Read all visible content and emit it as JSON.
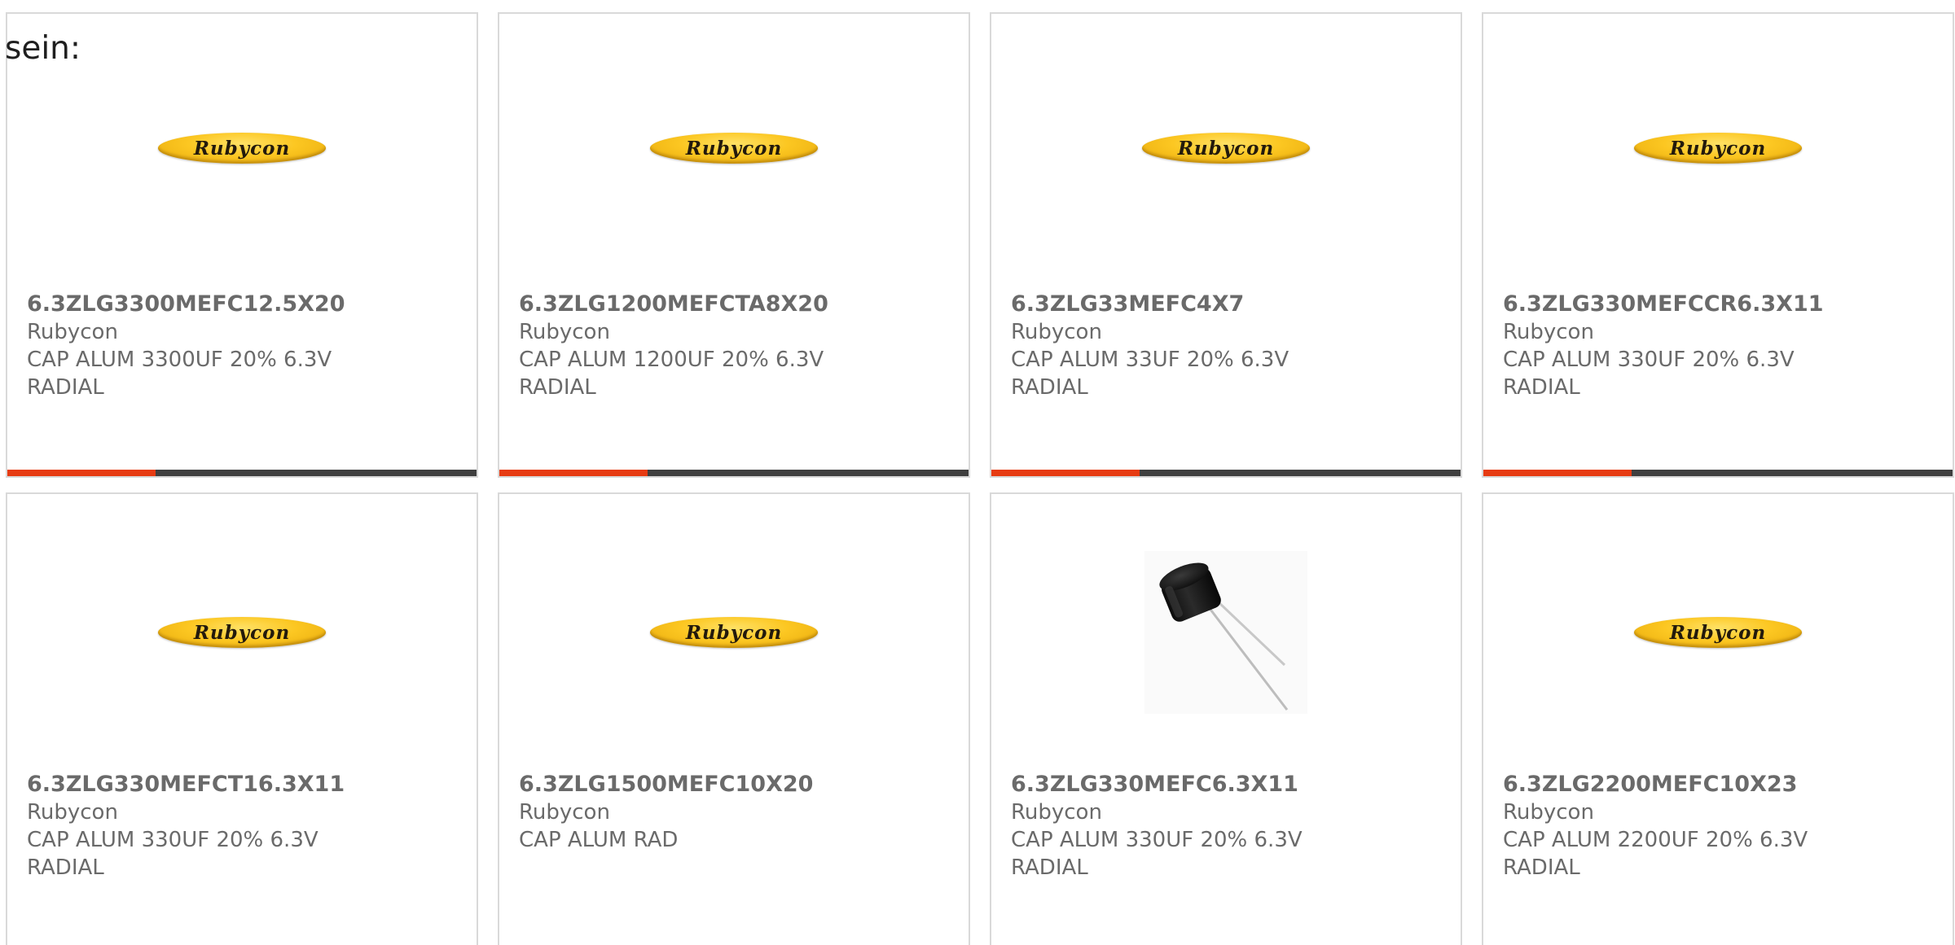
{
  "intro_text": "sein:",
  "colors": {
    "bar_dark": "#3f3f3f",
    "bar_accent": "#e63b12",
    "logo_yellow": "#fcc722"
  },
  "products": [
    {
      "part_number": "6.3ZLG3300MEFC12.5X20",
      "manufacturer": "Rubycon",
      "desc_line1": "CAP ALUM 3300UF 20% 6.3V",
      "desc_line2": "RADIAL",
      "image": {
        "type": "logo",
        "text": "Rubycon"
      }
    },
    {
      "part_number": "6.3ZLG1200MEFCTA8X20",
      "manufacturer": "Rubycon",
      "desc_line1": "CAP ALUM 1200UF 20% 6.3V",
      "desc_line2": "RADIAL",
      "image": {
        "type": "logo",
        "text": "Rubycon"
      }
    },
    {
      "part_number": "6.3ZLG33MEFC4X7",
      "manufacturer": "Rubycon",
      "desc_line1": "CAP ALUM 33UF 20% 6.3V",
      "desc_line2": "RADIAL",
      "image": {
        "type": "logo",
        "text": "Rubycon"
      }
    },
    {
      "part_number": "6.3ZLG330MEFCCR6.3X11",
      "manufacturer": "Rubycon",
      "desc_line1": "CAP ALUM 330UF 20% 6.3V",
      "desc_line2": "RADIAL",
      "image": {
        "type": "logo",
        "text": "Rubycon"
      }
    },
    {
      "part_number": "6.3ZLG330MEFCT16.3X11",
      "manufacturer": "Rubycon",
      "desc_line1": "CAP ALUM 330UF 20% 6.3V",
      "desc_line2": "RADIAL",
      "image": {
        "type": "logo",
        "text": "Rubycon"
      }
    },
    {
      "part_number": "6.3ZLG1500MEFC10X20",
      "manufacturer": "Rubycon",
      "desc_line1": "CAP ALUM RAD",
      "desc_line2": "",
      "image": {
        "type": "logo",
        "text": "Rubycon"
      }
    },
    {
      "part_number": "6.3ZLG330MEFC6.3X11",
      "manufacturer": "Rubycon",
      "desc_line1": "CAP ALUM 330UF 20% 6.3V",
      "desc_line2": "RADIAL",
      "image": {
        "type": "photo",
        "icon": "capacitor-photo-icon"
      }
    },
    {
      "part_number": "6.3ZLG2200MEFC10X23",
      "manufacturer": "Rubycon",
      "desc_line1": "CAP ALUM 2200UF 20% 6.3V",
      "desc_line2": "RADIAL",
      "image": {
        "type": "logo",
        "text": "Rubycon"
      }
    }
  ]
}
